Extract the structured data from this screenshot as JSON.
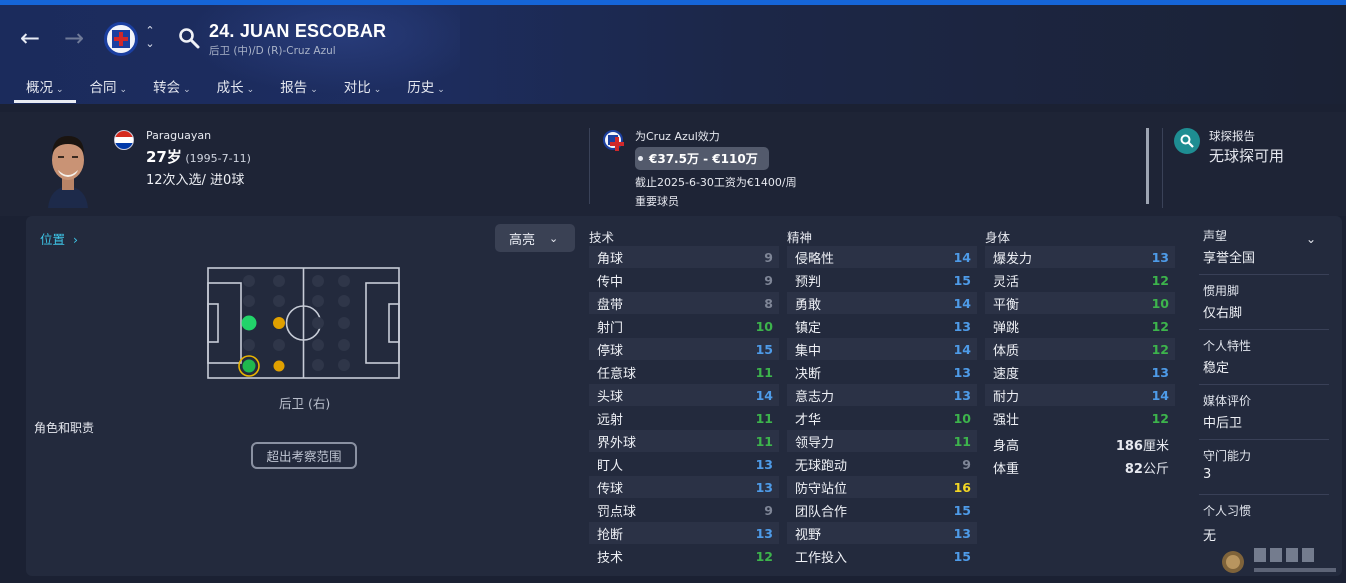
{
  "header": {
    "player_name": "24. JUAN ESCOBAR",
    "player_sub": "后卫 (中)/D (R)-Cruz Azul",
    "tabs": [
      {
        "label": "概况"
      },
      {
        "label": "合同"
      },
      {
        "label": "转会"
      },
      {
        "label": "成长"
      },
      {
        "label": "报告"
      },
      {
        "label": "对比"
      },
      {
        "label": "历史"
      }
    ]
  },
  "info": {
    "nationality": "Paraguayan",
    "age_big": "27岁",
    "dob": "(1995-7-11)",
    "caps": "12次入选/ 进0球",
    "club_line": "为Cruz Azul效力",
    "value_range": "€37.5万 - €110万",
    "contract": "截止2025-6-30工资为€1400/周",
    "squad_status": "重要球员",
    "scout_title": "球探报告",
    "scout_value": "无球探可用"
  },
  "position": {
    "title": "位置",
    "role_label": "后卫 (右)",
    "roles_duties": "角色和职责",
    "out_of_range": "超出考察范围",
    "highlight": "高亮"
  },
  "attributes": {
    "technical_title": "技术",
    "mental_title": "精神",
    "physical_title": "身体",
    "technical": [
      {
        "name": "角球",
        "value": "9",
        "color": "grey"
      },
      {
        "name": "传中",
        "value": "9",
        "color": "grey"
      },
      {
        "name": "盘带",
        "value": "8",
        "color": "grey"
      },
      {
        "name": "射门",
        "value": "10",
        "color": "green"
      },
      {
        "name": "停球",
        "value": "15",
        "color": "blue"
      },
      {
        "name": "任意球",
        "value": "11",
        "color": "green"
      },
      {
        "name": "头球",
        "value": "14",
        "color": "blue"
      },
      {
        "name": "远射",
        "value": "11",
        "color": "green"
      },
      {
        "name": "界外球",
        "value": "11",
        "color": "green"
      },
      {
        "name": "盯人",
        "value": "13",
        "color": "blue"
      },
      {
        "name": "传球",
        "value": "13",
        "color": "blue"
      },
      {
        "name": "罚点球",
        "value": "9",
        "color": "grey"
      },
      {
        "name": "抢断",
        "value": "13",
        "color": "blue"
      },
      {
        "name": "技术",
        "value": "12",
        "color": "green"
      }
    ],
    "mental": [
      {
        "name": "侵略性",
        "value": "14",
        "color": "blue"
      },
      {
        "name": "预判",
        "value": "15",
        "color": "blue"
      },
      {
        "name": "勇敢",
        "value": "14",
        "color": "blue"
      },
      {
        "name": "镇定",
        "value": "13",
        "color": "blue"
      },
      {
        "name": "集中",
        "value": "14",
        "color": "blue"
      },
      {
        "name": "决断",
        "value": "13",
        "color": "blue"
      },
      {
        "name": "意志力",
        "value": "13",
        "color": "blue"
      },
      {
        "name": "才华",
        "value": "10",
        "color": "green"
      },
      {
        "name": "领导力",
        "value": "11",
        "color": "green"
      },
      {
        "name": "无球跑动",
        "value": "9",
        "color": "grey"
      },
      {
        "name": "防守站位",
        "value": "16",
        "color": "yellow"
      },
      {
        "name": "团队合作",
        "value": "15",
        "color": "blue"
      },
      {
        "name": "视野",
        "value": "13",
        "color": "blue"
      },
      {
        "name": "工作投入",
        "value": "15",
        "color": "blue"
      }
    ],
    "physical": [
      {
        "name": "爆发力",
        "value": "13",
        "color": "blue"
      },
      {
        "name": "灵活",
        "value": "12",
        "color": "green"
      },
      {
        "name": "平衡",
        "value": "10",
        "color": "green"
      },
      {
        "name": "弹跳",
        "value": "12",
        "color": "green"
      },
      {
        "name": "体质",
        "value": "12",
        "color": "green"
      },
      {
        "name": "速度",
        "value": "13",
        "color": "blue"
      },
      {
        "name": "耐力",
        "value": "14",
        "color": "blue"
      },
      {
        "name": "强壮",
        "value": "12",
        "color": "green"
      }
    ],
    "height_label": "身高",
    "height_num": "186",
    "height_unit": "厘米",
    "weight_label": "体重",
    "weight_num": "82",
    "weight_unit": "公斤"
  },
  "side": {
    "reputation_label": "声望",
    "reputation_value": "享誉全国",
    "foot_label": "惯用脚",
    "foot_value": "仅右脚",
    "personality_label": "个人特性",
    "personality_value": "稳定",
    "media_label": "媒体评价",
    "media_value": "中后卫",
    "gk_label": "守门能力",
    "gk_value": "3",
    "habits_label": "个人习惯",
    "habits_value": "无"
  },
  "colors": {
    "grey": "#7f8697",
    "green": "#3db44c",
    "blue": "#4e9be8",
    "yellow": "#f2d624",
    "accent": "#1565d8"
  }
}
